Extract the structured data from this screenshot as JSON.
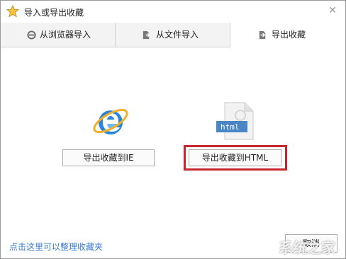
{
  "window": {
    "title": "导入或导出收藏",
    "close_glyph": "✕",
    "icons": {
      "title": "star-icon",
      "close": "close-icon"
    }
  },
  "tabs": [
    {
      "label": "从浏览器导入",
      "icon": "browser-import-icon",
      "selected": false
    },
    {
      "label": "从文件导入",
      "icon": "file-import-icon",
      "selected": false
    },
    {
      "label": "导出收藏",
      "icon": "export-icon",
      "selected": true
    }
  ],
  "main": {
    "export_ie_label": "导出收藏到IE",
    "export_html_label": "导出收藏到HTML",
    "html_file_badge": "html",
    "ie_icon": "internet-explorer-icon",
    "html_icon": "html-file-icon",
    "highlight_color": "#c8262e"
  },
  "footer": {
    "organize_link": "点击这里可以整理收藏夹",
    "cancel_label": "取消"
  },
  "watermark": "系统之家"
}
